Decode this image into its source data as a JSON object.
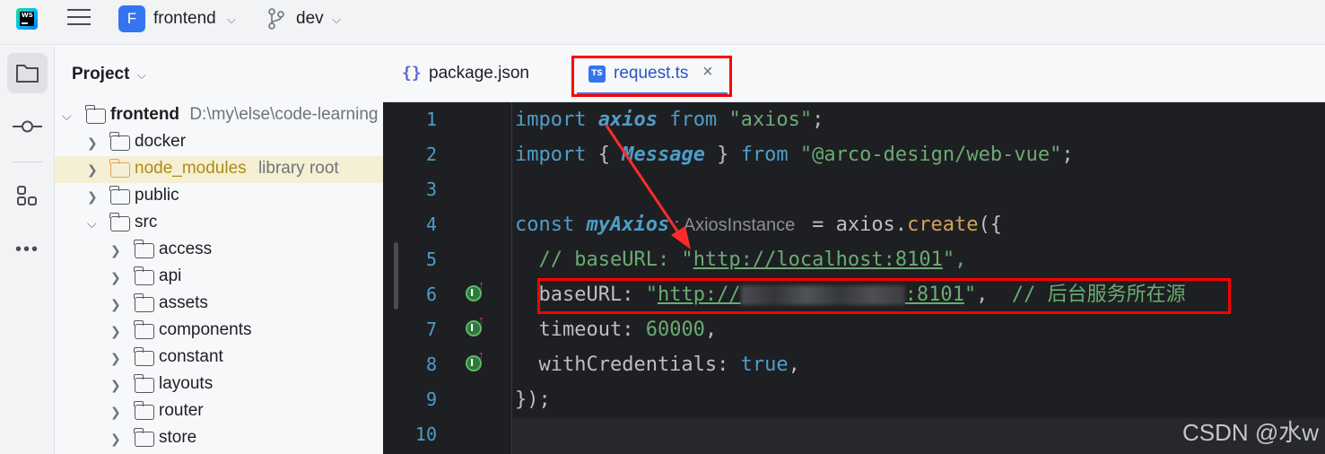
{
  "topbar": {
    "logo_text": "WS",
    "project_badge": "F",
    "project_name": "frontend",
    "branch_name": "dev"
  },
  "project_panel": {
    "title": "Project",
    "root": {
      "name": "frontend",
      "path": "D:\\my\\else\\code-learning"
    },
    "items": [
      {
        "name": "docker",
        "sub": ""
      },
      {
        "name": "node_modules",
        "sub": "library root"
      },
      {
        "name": "public",
        "sub": ""
      },
      {
        "name": "src",
        "sub": ""
      },
      {
        "name": "access",
        "sub": ""
      },
      {
        "name": "api",
        "sub": ""
      },
      {
        "name": "assets",
        "sub": ""
      },
      {
        "name": "components",
        "sub": ""
      },
      {
        "name": "constant",
        "sub": ""
      },
      {
        "name": "layouts",
        "sub": ""
      },
      {
        "name": "router",
        "sub": ""
      },
      {
        "name": "store",
        "sub": ""
      }
    ]
  },
  "tabs": [
    {
      "label": "package.json",
      "icon": "json-file-icon",
      "active": false
    },
    {
      "label": "request.ts",
      "icon": "typescript-file-icon",
      "active": true,
      "close": "×"
    }
  ],
  "editor": {
    "line_numbers": [
      "1",
      "2",
      "3",
      "4",
      "5",
      "6",
      "7",
      "8",
      "9",
      "10"
    ],
    "lines": {
      "l1": {
        "a": "import ",
        "b": "axios",
        "c": " from ",
        "d": "\"axios\"",
        "e": ";"
      },
      "l2": {
        "a": "import ",
        "b": "{ ",
        "c": "Message",
        "d": " } ",
        "e": "from ",
        "f": "\"@arco-design/web-vue\"",
        "g": ";"
      },
      "l4": {
        "a": "const ",
        "b": "myAxios",
        "hint": " : AxiosInstance ",
        "c": " = axios.",
        "d": "create",
        "e": "({"
      },
      "l5": {
        "a": "  // baseURL: \"",
        "b": "http://localhost:8101",
        "c": "\","
      },
      "l6": {
        "a": "  baseURL: ",
        "b": "\"",
        "c": "http://",
        "d": ":8101",
        "e": "\"",
        "f": ",  ",
        "g": "// 后台服务所在源"
      },
      "l7": {
        "a": "  timeout: ",
        "b": "60000",
        "c": ","
      },
      "l8": {
        "a": "  withCredentials: ",
        "b": "true",
        "c": ","
      },
      "l9": {
        "a": "});"
      }
    }
  },
  "watermark": "CSDN @水w",
  "colors": {
    "accent": "#3574f0",
    "annotation_red": "#ff0000",
    "editor_bg": "#1e1f22",
    "keyword": "#4e9ec9",
    "string": "#6aab73"
  }
}
